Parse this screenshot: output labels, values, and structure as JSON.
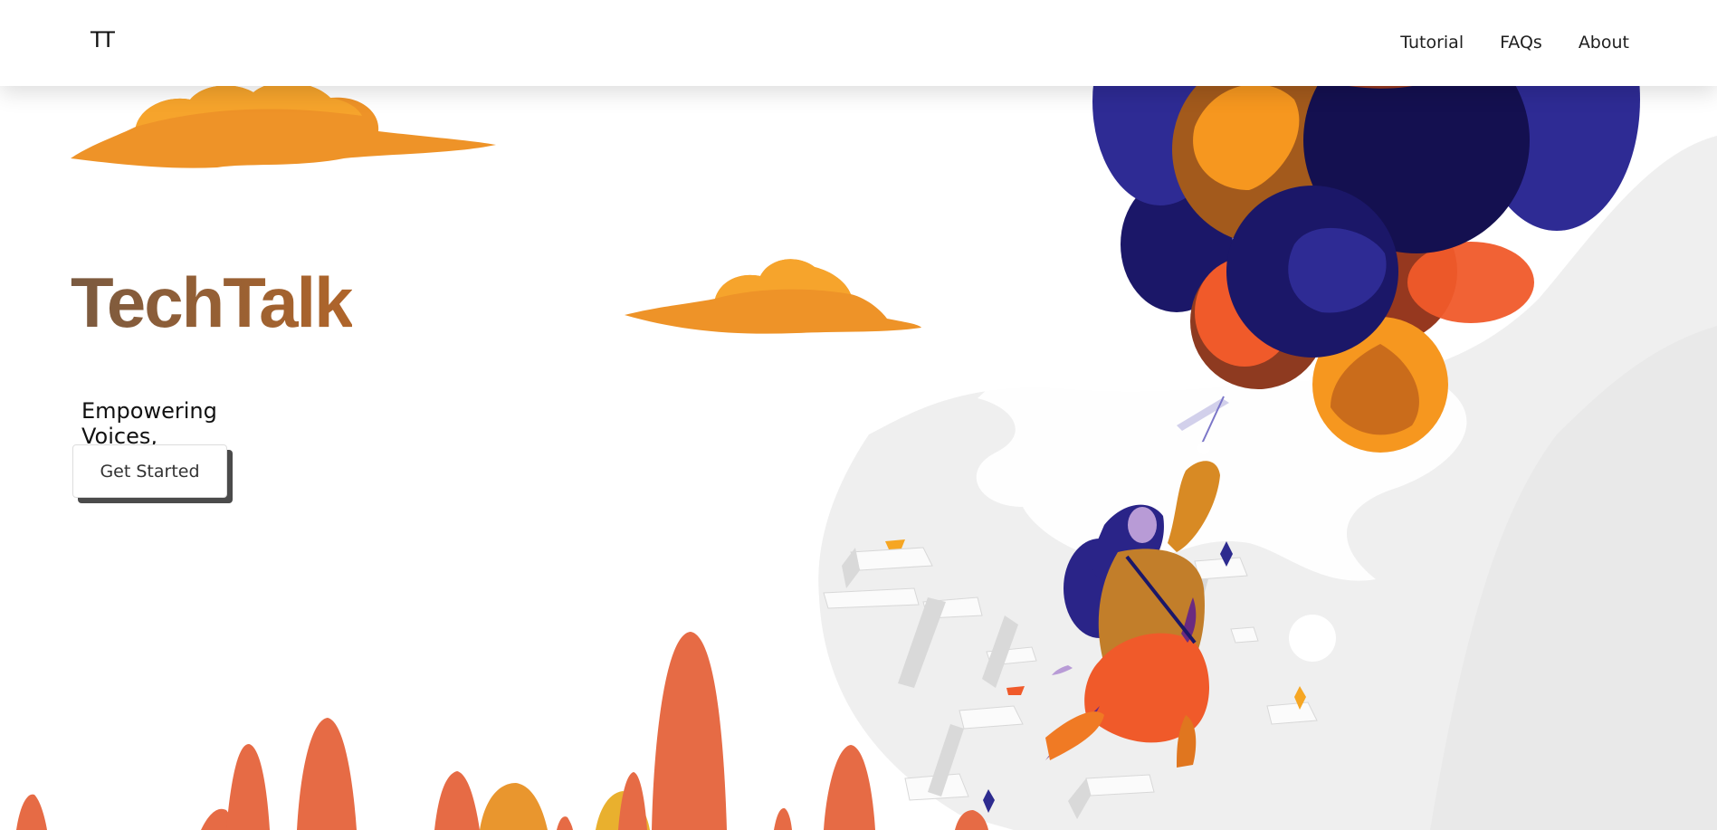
{
  "nav": {
    "logo": "TT",
    "links": [
      "Tutorial",
      "FAQs",
      "About"
    ]
  },
  "hero": {
    "title": "TechTalk",
    "subtitle": "Empowering Voices, Enriching Education.",
    "cta_label": "Get Started"
  },
  "colors": {
    "title_gradient_start": "#7a5a40",
    "title_gradient_end": "#b0652a",
    "cloud": "#f2962a",
    "spike": "#e66b45",
    "balloon_navy": "#26217a",
    "balloon_orange": "#f2602a"
  },
  "illustrations": [
    "cloud-left",
    "cloud-center",
    "balloons",
    "woman-figure",
    "building-scene",
    "orange-spikes"
  ]
}
